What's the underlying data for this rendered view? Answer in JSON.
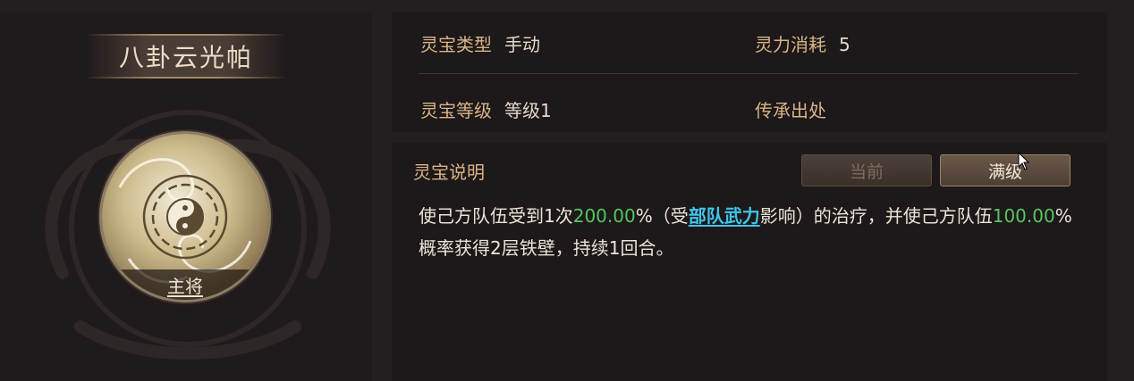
{
  "item": {
    "name": "八卦云光帕",
    "role_label": "主将"
  },
  "info": {
    "type_label": "灵宝类型",
    "type_value": "手动",
    "cost_label": "灵力消耗",
    "cost_value": "5",
    "level_label": "灵宝等级",
    "level_value": "等级1",
    "origin_label": "传承出处",
    "origin_value": ""
  },
  "description": {
    "title": "灵宝说明",
    "tabs": {
      "current": "当前",
      "max": "满级"
    },
    "selected_tab": "满级",
    "segments": {
      "s1": "使己方队伍受到1次",
      "v1": "200.00",
      "s2": "%（受",
      "link": "部队武力",
      "s3": "影响）的治疗，并使己方队伍",
      "v2": "100.00",
      "s4": "%概率获得2层铁壁，持续1回合。"
    }
  },
  "colors": {
    "accent_gold": "#d8b587",
    "value_green": "#55c65f",
    "link_blue": "#3fc5ea"
  }
}
